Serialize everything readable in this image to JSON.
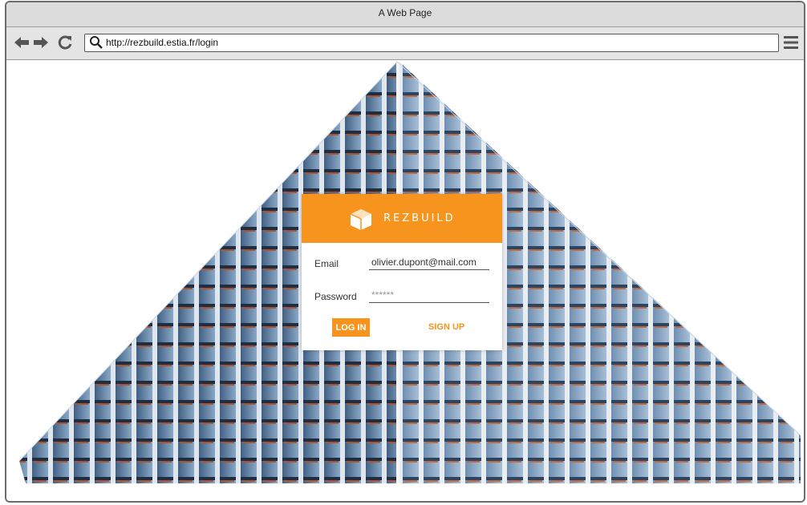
{
  "window": {
    "title": "A Web Page"
  },
  "toolbar": {
    "back_icon": "arrow-left-icon",
    "forward_icon": "arrow-right-icon",
    "reload_icon": "reload-icon",
    "search_icon": "search-icon",
    "menu_icon": "hamburger-menu-icon",
    "url": "http://rezbuild.estia.fr/login"
  },
  "login": {
    "brand": "REZBUILD",
    "brand_icon": "rezbuild-logo-icon",
    "email_label": "Email",
    "email_value": "olivier.dupont@mail.com",
    "password_label": "Password",
    "password_placeholder": "******",
    "login_button": "LOG IN",
    "signup_link": "SIGN UP"
  },
  "colors": {
    "accent": "#f7941d",
    "chrome": "#e4e4e4",
    "titlebar": "#dcdcdc"
  }
}
